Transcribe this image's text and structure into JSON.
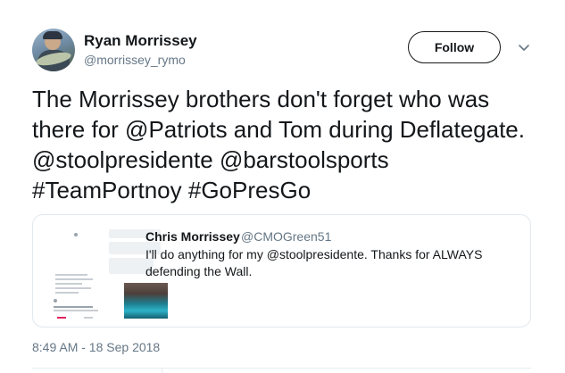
{
  "tweet": {
    "author_name": "Ryan Morrissey",
    "author_handle": "@morrissey_rymo",
    "follow_label": "Follow",
    "text": "The Morrissey brothers don't forget who was there for @Patriots and Tom during Deflategate. @stoolpresidente @barstoolsports #TeamPortnoy #GoPresGo",
    "timestamp": "8:49 AM - 18 Sep 2018"
  },
  "quoted_tweet": {
    "author_name": "Chris Morrissey",
    "author_handle": "@CMOGreen51",
    "text": "I'll do anything for my @stoolpresidente. Thanks for ALWAYS defending the Wall."
  },
  "icons": {
    "more": "chevron-down-icon"
  },
  "colors": {
    "text": "#14171a",
    "muted": "#657786",
    "border": "#e1e8ed"
  }
}
